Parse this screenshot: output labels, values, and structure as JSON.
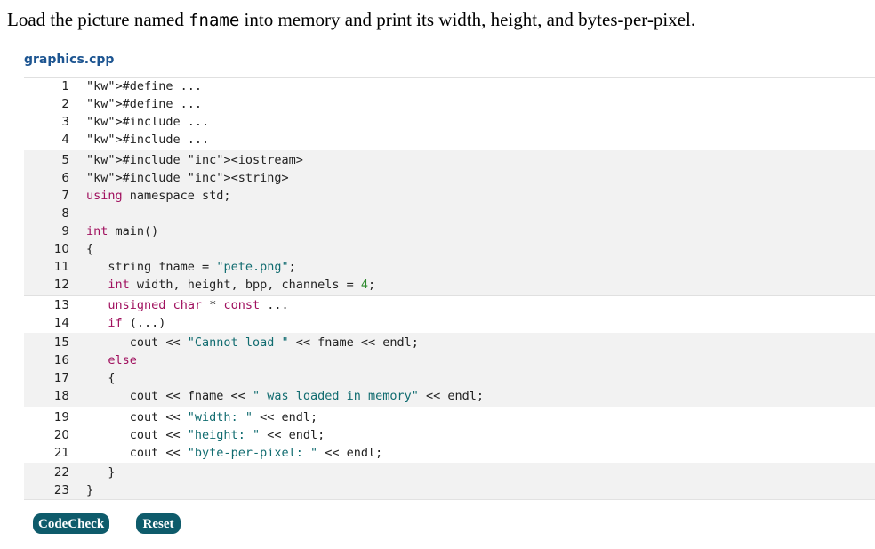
{
  "prompt": {
    "before": "Load the picture named ",
    "code_word": "fname",
    "after": " into memory and print its width, height, and bytes-per-pixel."
  },
  "filename": "graphics.cpp",
  "lines": [
    {
      "n": "1",
      "t": "#define ..."
    },
    {
      "n": "2",
      "t": "#define ..."
    },
    {
      "n": "3",
      "t": "#include ..."
    },
    {
      "n": "4",
      "t": "#include ..."
    },
    {
      "n": "5",
      "t": "#include <iostream>"
    },
    {
      "n": "6",
      "t": "#include <string>"
    },
    {
      "n": "7",
      "t": "using namespace std;"
    },
    {
      "n": "8",
      "t": ""
    },
    {
      "n": "9",
      "t": "int main()"
    },
    {
      "n": "10",
      "t": "{"
    },
    {
      "n": "11",
      "t": "   string fname = \"pete.png\";"
    },
    {
      "n": "12",
      "t": "   int width, height, bpp, channels = 4;"
    },
    {
      "n": "13",
      "t": "   unsigned char * const ..."
    },
    {
      "n": "14",
      "t": "   if (...)"
    },
    {
      "n": "15",
      "t": "      cout << \"Cannot load \" << fname << endl;"
    },
    {
      "n": "16",
      "t": "   else"
    },
    {
      "n": "17",
      "t": "   {"
    },
    {
      "n": "18",
      "t": "      cout << fname << \" was loaded in memory\" << endl;"
    },
    {
      "n": "19",
      "t": "      cout << \"width: \" << endl;"
    },
    {
      "n": "20",
      "t": "      cout << \"height: \" << endl;"
    },
    {
      "n": "21",
      "t": "      cout << \"byte-per-pixel: \" << endl;"
    },
    {
      "n": "22",
      "t": "   }"
    },
    {
      "n": "23",
      "t": "}"
    }
  ],
  "buttons": {
    "codecheck": "CodeCheck",
    "reset": "Reset"
  },
  "colors": {
    "filename": "#1d5591",
    "button_bg": "#0e5b6b",
    "readonly_bg": "#f2f2f2",
    "keyword": "#a0105e",
    "string": "#116c70",
    "include_target": "#c0501a",
    "number": "#2d8a2d"
  }
}
